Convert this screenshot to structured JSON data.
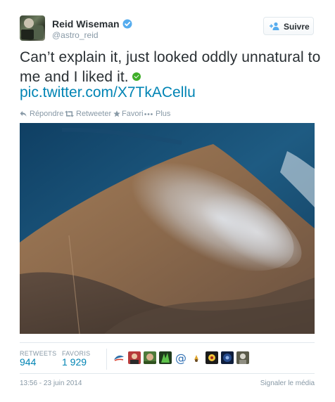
{
  "header": {
    "name": "Reid Wiseman",
    "handle": "@astro_reid",
    "follow_label": "Suivre"
  },
  "tweet": {
    "text": "Can’t explain it, just looked oddly unnatural to me and I liked it.",
    "link": "pic.twitter.com/X7TkACellu"
  },
  "actions": {
    "reply": "Répondre",
    "retweet": "Retweeter",
    "favorite": "Favori",
    "more": "Plus"
  },
  "stats": {
    "retweets_label": "RETWEETS",
    "retweets_value": "944",
    "favorites_label": "FAVORIS",
    "favorites_value": "1 929"
  },
  "footer": {
    "timestamp": "13:56 - 23 juin 2014",
    "report": "Signaler le média"
  },
  "colors": {
    "link": "#0084b4",
    "muted": "#8899a6",
    "text": "#292f33",
    "verified": "#55acee"
  },
  "icons": {
    "verified": "verified-badge-icon",
    "follow": "add-user-icon",
    "reply": "reply-icon",
    "retweet": "retweet-icon",
    "favorite": "star-icon",
    "more": "more-dots-icon",
    "green_check": "green-check-emoji-icon"
  }
}
